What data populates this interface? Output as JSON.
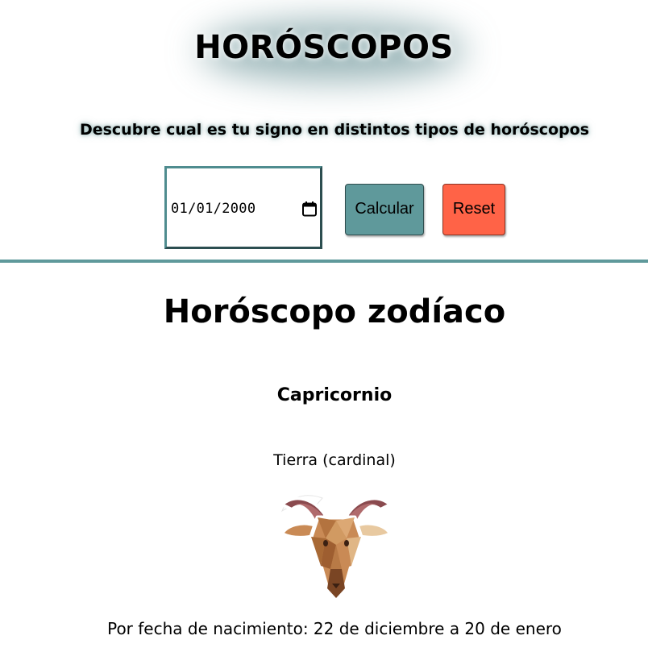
{
  "header": {
    "title": "HORÓSCOPOS",
    "subtitle": "Descubre cual es tu signo en distintos tipos de horóscopos"
  },
  "form": {
    "date_value": "01/01/2000",
    "calendar_icon": "calendar-icon",
    "calculate_label": "Calcular",
    "reset_label": "Reset"
  },
  "colors": {
    "accent": "#5f999b",
    "reset": "#ff6347"
  },
  "result": {
    "section_title": "Horóscopo zodíaco",
    "sign": "Capricornio",
    "element": "Tierra (cardinal)",
    "image_icon": "capricorn-goat-icon",
    "date_range": "Por fecha de nacimiento: 22 de diciembre a 20 de enero"
  }
}
